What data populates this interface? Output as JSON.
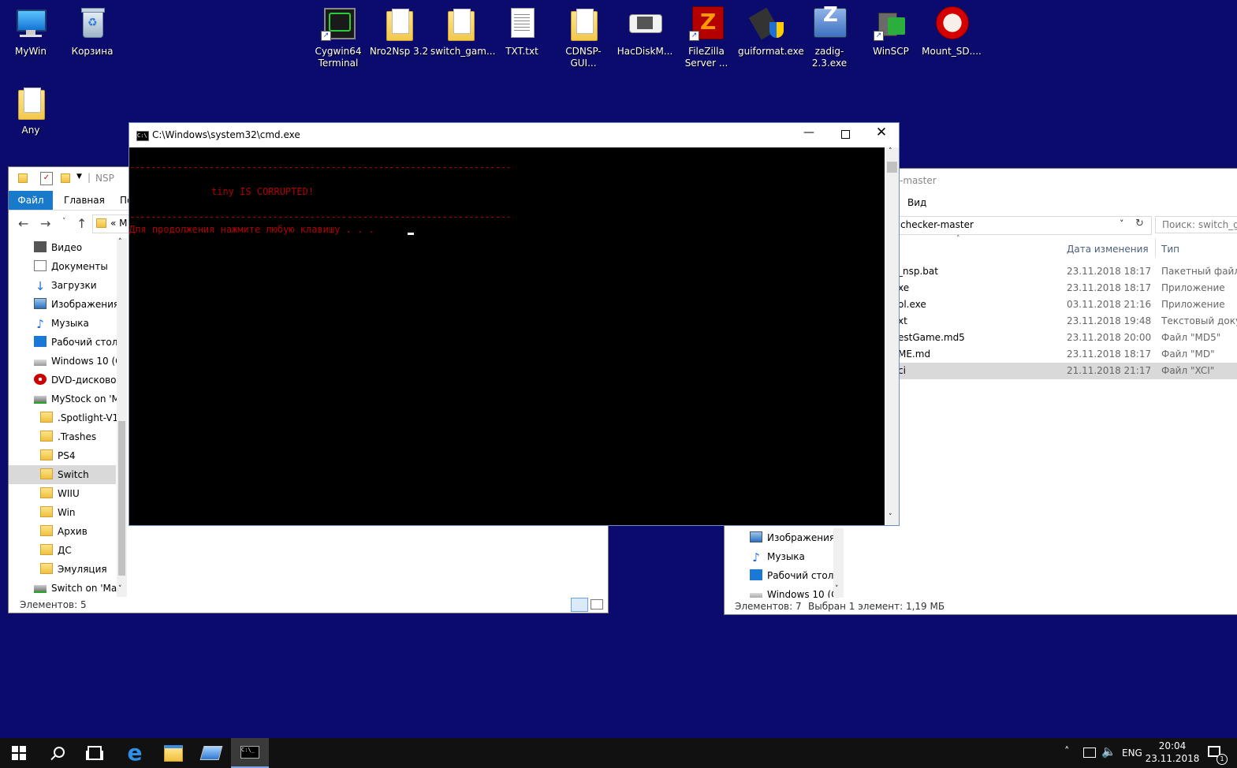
{
  "desktop": {
    "icons": [
      {
        "label": "MyWin"
      },
      {
        "label": "Корзина"
      },
      {
        "label": "Cygwin64 Terminal"
      },
      {
        "label": "Nro2Nsp 3.2"
      },
      {
        "label": "switch_gam..."
      },
      {
        "label": "TXT.txt"
      },
      {
        "label": "CDNSP-GUI..."
      },
      {
        "label": "HacDiskM..."
      },
      {
        "label": "FileZilla Server ..."
      },
      {
        "label": "guiformat.exe"
      },
      {
        "label": "zadig-2.3.exe"
      },
      {
        "label": "WinSCP"
      },
      {
        "label": "Mount_SD...."
      },
      {
        "label": "Any"
      }
    ]
  },
  "explorer_left": {
    "title": "NSP",
    "ribbon_tabs": [
      "Файл",
      "Главная",
      "По"
    ],
    "address": "« M",
    "nav": [
      "Видео",
      "Документы",
      "Загрузки",
      "Изображения",
      "Музыка",
      "Рабочий стол",
      "Windows 10 (C:",
      "DVD-дисковод",
      "MyStock on 'Ma",
      ".Spotlight-V10",
      ".Trashes",
      "PS4",
      "Switch",
      "WIIU",
      "Win",
      "Архив",
      "ДС",
      "Эмуляция",
      "Switch on 'Mac'"
    ],
    "status": "Элементов: 5"
  },
  "explorer_right": {
    "title": "-master",
    "ribbon_tab": "Вид",
    "address": "checker-master",
    "search_placeholder": "Поиск: switch_ga",
    "col_date": "Дата изменения",
    "col_type": "Тип",
    "files": [
      {
        "name": "_nsp.bat",
        "date": "23.11.2018 18:17",
        "type": "Пакетный файл ..."
      },
      {
        "name": "xe",
        "date": "23.11.2018 18:17",
        "type": "Приложение"
      },
      {
        "name": "ol.exe",
        "date": "03.11.2018 21:16",
        "type": "Приложение"
      },
      {
        "name": "xt",
        "date": "23.11.2018 19:48",
        "type": "Текстовый доку"
      },
      {
        "name": "estGame.md5",
        "date": "23.11.2018 20:00",
        "type": "Файл \"MD5\""
      },
      {
        "name": "ME.md",
        "date": "23.11.2018 18:17",
        "type": "Файл \"MD\""
      },
      {
        "name": "ci",
        "date": "21.11.2018 21:17",
        "type": "Файл \"XCI\""
      }
    ],
    "nav": [
      "Изображения",
      "Музыка",
      "Рабочий стол",
      "Windows 10 (C:"
    ],
    "status_count": "Элементов: 7",
    "status_selected": "Выбран 1 элемент: 1,19 МБ"
  },
  "cmd": {
    "title": "C:\\Windows\\system32\\cmd.exe",
    "separator": "------------------------------------------------------------------------",
    "message": "tiny IS CORRUPTED!",
    "prompt": "Для продолжения нажмите любую клавишу . . ."
  },
  "taskbar": {
    "lang": "ENG",
    "time": "20:04",
    "date": "23.11.2018",
    "notif_count": "1"
  }
}
